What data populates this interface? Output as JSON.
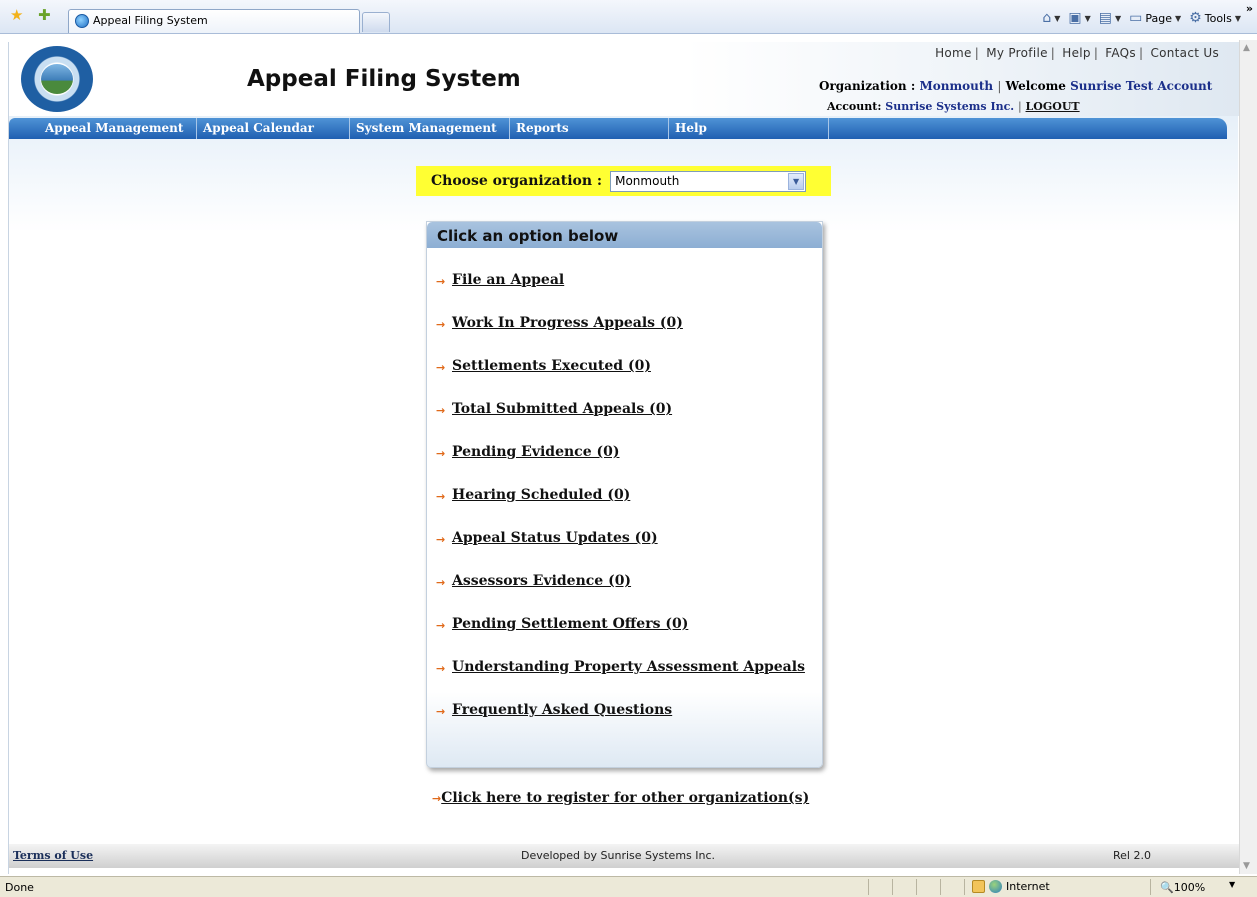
{
  "browser": {
    "tab_title": "Appeal Filing System",
    "commands": {
      "page": "Page",
      "tools": "Tools"
    },
    "status_text": "Done",
    "zone": "Internet",
    "zoom": "100%"
  },
  "header": {
    "title": "Appeal Filing System",
    "top_links": [
      "Home",
      "My Profile",
      "Help",
      "FAQs",
      "Contact Us"
    ],
    "organization_label": "Organization :",
    "organization_value": "Monmouth",
    "welcome_label": "Welcome",
    "welcome_value": "Sunrise Test Account",
    "account_label": "Account:",
    "account_value": "Sunrise Systems Inc.",
    "logout": "LOGOUT"
  },
  "nav": [
    "Appeal Management",
    "Appeal Calendar",
    "System Management",
    "Reports",
    "Help"
  ],
  "org_select": {
    "label": "Choose organization :",
    "value": "Monmouth"
  },
  "options": {
    "heading": "Click an option below",
    "items": [
      "File an Appeal",
      "Work In Progress Appeals (0)",
      "Settlements Executed (0)",
      "Total Submitted Appeals (0)",
      "Pending Evidence (0)",
      "Hearing Scheduled (0)",
      "Appeal Status Updates (0)",
      "Assessors Evidence (0)",
      "Pending Settlement Offers (0)",
      "Understanding Property Assessment Appeals",
      "Frequently Asked Questions"
    ]
  },
  "register_link": "Click here to register for other organization(s)",
  "footer": {
    "terms": "Terms of Use",
    "developed_by": "Developed by Sunrise Systems Inc.",
    "release": "Rel 2.0"
  },
  "colors": {
    "nav_blue": "#1f5fb1",
    "highlight_yellow": "#ffff33",
    "arrow_orange": "#e0691a",
    "account_navy": "#1b2f8a"
  }
}
